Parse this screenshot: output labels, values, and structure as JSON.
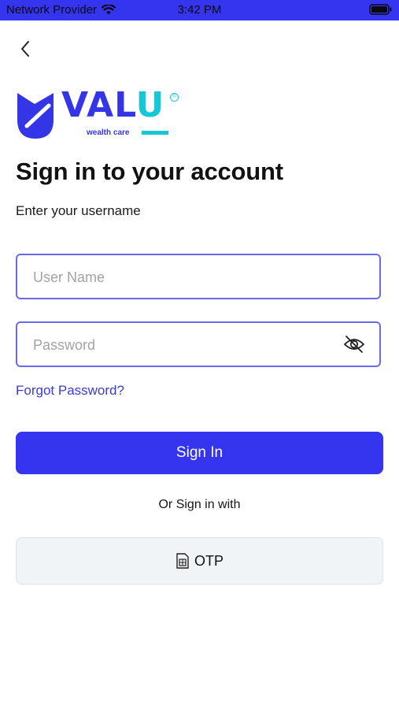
{
  "status_bar": {
    "carrier": "Network Provider",
    "time": "3:42 PM",
    "wifi_icon": "wifi-icon",
    "battery_icon": "battery-icon"
  },
  "navigation": {
    "back_icon": "chevron-left-icon"
  },
  "logo": {
    "wordmark_main": "VAL",
    "wordmark_accent": "U",
    "tagline": "wealth care",
    "brand_color": "#3535e8",
    "accent_color": "#16c7d6"
  },
  "page": {
    "title": "Sign in to your account",
    "subtitle": "Enter your username"
  },
  "form": {
    "username": {
      "placeholder": "User Name",
      "value": ""
    },
    "password": {
      "placeholder": "Password",
      "value": "",
      "toggle_icon": "eye-off-icon"
    },
    "forgot_password_label": "Forgot Password?",
    "sign_in_label": "Sign In",
    "or_text": "Or Sign in with",
    "otp_label": "OTP",
    "otp_icon": "sim-card-icon"
  },
  "colors": {
    "primary": "#3535f0",
    "link": "#3b3bd6",
    "field_border": "#6b6bea",
    "secondary_button_bg": "#f1f4f7"
  }
}
